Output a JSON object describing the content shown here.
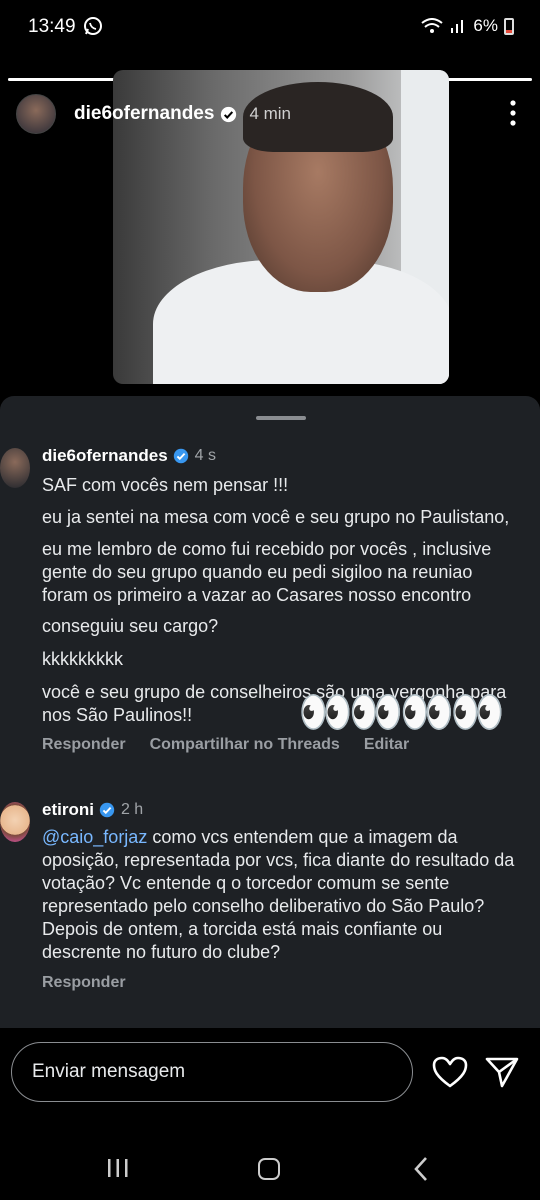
{
  "status_bar": {
    "time": "13:49",
    "battery": "6%"
  },
  "story": {
    "progress": 1.0,
    "username": "die6ofernandes",
    "time_ago": "4 min"
  },
  "comments": [
    {
      "username": "die6ofernandes",
      "time": "4 s",
      "lines": [
        "SAF com vocês nem pensar !!!",
        "eu ja sentei na mesa com você e seu grupo no Paulistano,",
        "eu me lembro de como fui recebido por vocês , inclusive gente do seu grupo quando eu pedi sigiloo na reuniao foram os primeiro a vazar ao Casares nosso encontro",
        "conseguiu seu cargo?",
        "kkkkkkkkk",
        "você e seu grupo de conselheiros são uma vergonha para nos São Paulinos!!"
      ],
      "emoji": "👀👀👀👀",
      "actions": [
        "Responder",
        "Compartilhar no Threads",
        "Editar"
      ]
    },
    {
      "username": "etironi",
      "time": "2 h",
      "mention": "@caio_forjaz",
      "text": " como vcs entendem que a imagem da oposição, representada por vcs, fica diante do resultado da votação?  Vc entende q o torcedor comum se sente representado pelo conselho deliberativo do São Paulo? Depois de ontem, a torcida está mais confiante ou descrente no futuro do clube?",
      "actions": [
        "Responder"
      ]
    }
  ],
  "composer": {
    "placeholder": "Enviar mensagem"
  },
  "icons": {
    "status_left": "whatsapp-icon",
    "status_right": [
      "wifi-icon",
      "signal-icon",
      "battery-icon"
    ],
    "story_header": [
      "verified-icon",
      "more-icon"
    ],
    "composer": [
      "heart-icon",
      "send-icon"
    ],
    "nav": [
      "recent-apps-icon",
      "home-icon",
      "back-icon"
    ]
  },
  "colors": {
    "sheet_bg": "#1e2125",
    "mention": "#79b8ff",
    "verified": "#3897f0"
  }
}
